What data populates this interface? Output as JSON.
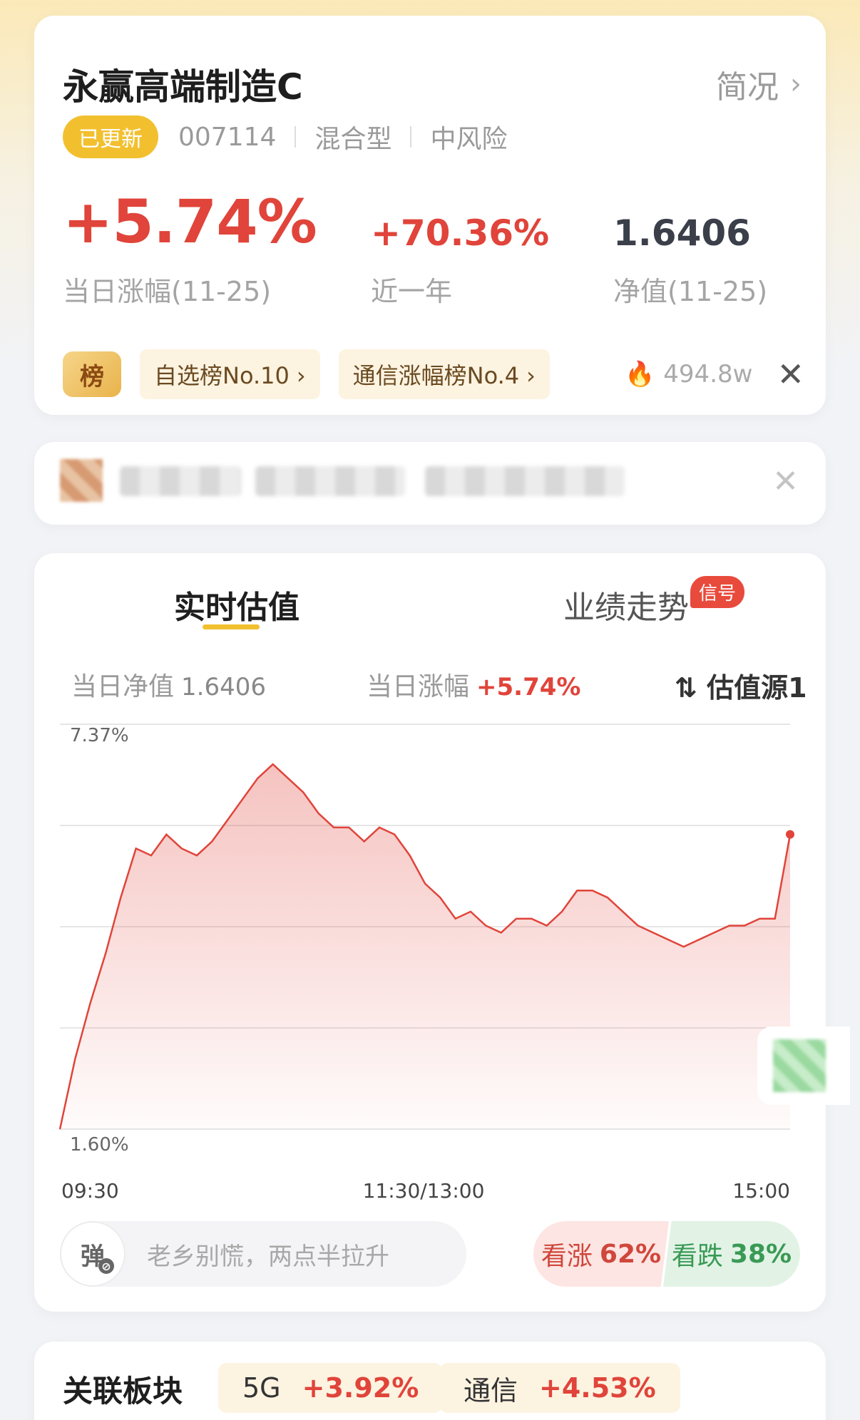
{
  "fund": {
    "name": "永赢高端制造C",
    "overview_label": "简况",
    "updated_badge": "已更新",
    "code": "007114",
    "type": "混合型",
    "risk": "中风险",
    "day_change": "+5.74%",
    "day_change_label": "当日涨幅(11-25)",
    "year_change": "+70.36%",
    "year_change_label": "近一年",
    "nav": "1.6406",
    "nav_label": "净值(11-25)",
    "rank_badge": "榜",
    "rank_chips": [
      "自选榜No.10",
      "通信涨幅榜No.4"
    ],
    "hot_count": "494.8w"
  },
  "tabs": {
    "realtime": "实时估值",
    "performance": "业绩走势",
    "signal_badge": "信号"
  },
  "estimate": {
    "nav_label": "当日净值",
    "nav_value": "1.6406",
    "change_label": "当日涨幅",
    "change_value": "+5.74%",
    "source_label": "估值源1"
  },
  "chart_data": {
    "type": "area",
    "y_top_label": "7.37%",
    "y_bottom_label": "1.60%",
    "ylim": [
      1.6,
      7.37
    ],
    "x_tick_labels": [
      "09:30",
      "11:30/13:00",
      "15:00"
    ],
    "series_color": "#e0443a",
    "grid": true,
    "x": [
      0,
      5,
      10,
      15,
      20,
      25,
      30,
      35,
      40,
      45,
      50,
      55,
      60,
      65,
      70,
      75,
      80,
      85,
      90,
      95,
      100,
      105,
      110,
      115,
      120,
      125,
      130,
      135,
      140,
      145,
      150,
      155,
      160,
      165,
      170,
      175,
      180,
      185,
      190,
      195,
      200,
      205,
      210,
      215,
      220,
      225,
      230,
      235,
      240
    ],
    "values": [
      1.6,
      2.6,
      3.4,
      4.1,
      4.9,
      5.6,
      5.5,
      5.8,
      5.6,
      5.5,
      5.7,
      6.0,
      6.3,
      6.6,
      6.8,
      6.6,
      6.4,
      6.1,
      5.9,
      5.9,
      5.7,
      5.9,
      5.8,
      5.5,
      5.1,
      4.9,
      4.6,
      4.7,
      4.5,
      4.4,
      4.6,
      4.6,
      4.5,
      4.7,
      5.0,
      5.0,
      4.9,
      4.7,
      4.5,
      4.4,
      4.3,
      4.2,
      4.3,
      4.4,
      4.5,
      4.5,
      4.6,
      4.6,
      5.8
    ]
  },
  "comment": {
    "danmu_icon": "弹",
    "placeholder": "老乡别慌，两点半拉升"
  },
  "vote": {
    "up_label": "看涨",
    "up_pct": "62%",
    "down_label": "看跌",
    "down_pct": "38%"
  },
  "sectors": {
    "title": "关联板块",
    "items": [
      {
        "name": "5G",
        "change": "+3.92%"
      },
      {
        "name": "通信",
        "change": "+4.53%"
      }
    ]
  },
  "colors": {
    "rise": "#e0443a",
    "fall": "#3a9a55",
    "accent": "#f2c02f"
  }
}
